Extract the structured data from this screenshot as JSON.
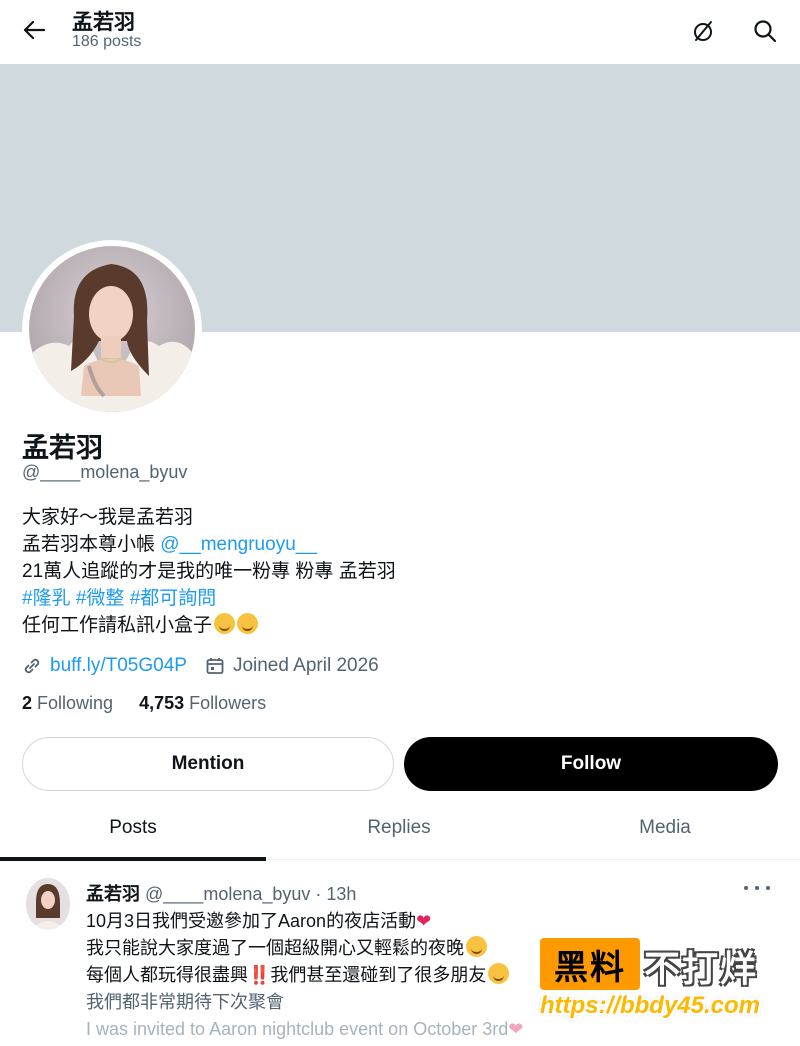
{
  "header": {
    "name": "孟若羽",
    "posts_count": "186 posts"
  },
  "profile": {
    "display_name": "孟若羽",
    "handle": "@____molena_byuv",
    "bio": {
      "line1": "大家好〜我是孟若羽",
      "line2_text": "孟若羽本尊小帳 ",
      "line2_link": "@__mengruoyu__",
      "line3": "21萬人追蹤的才是我的唯一粉專 粉專 孟若羽",
      "hashtags": [
        "#隆乳",
        "#微整",
        "#都可詢問"
      ],
      "line5": "任何工作請私訊小盒子"
    },
    "website": "buff.ly/T05G04P",
    "joined": "Joined April 2026",
    "following_count": "2",
    "following_label": "Following",
    "followers_count": "4,753",
    "followers_label": "Followers"
  },
  "buttons": {
    "mention": "Mention",
    "follow": "Follow"
  },
  "tabs": [
    {
      "label": "Posts",
      "active": true
    },
    {
      "label": "Replies",
      "active": false
    },
    {
      "label": "Media",
      "active": false
    }
  ],
  "post": {
    "name": "孟若羽",
    "meta": "@____molena_byuv · 13h",
    "lines": [
      "10月3日我們受邀參加了Aaron的夜店活動",
      "我只能說大家度過了一個超級開心又輕鬆的夜晚",
      "每個人都玩得很盡興‼️我們甚至還碰到了很多朋友",
      "我們都非常期待下次聚會",
      "I was invited to Aaron nightclub event on October 3rd"
    ]
  },
  "watermark": {
    "box_text": "黑料",
    "side_text": "不打烊",
    "url": "https://bbdy45.com"
  },
  "colors": {
    "accent": "#1d9bf0",
    "banner": "#cfd9de",
    "follow_button": "#000000"
  }
}
